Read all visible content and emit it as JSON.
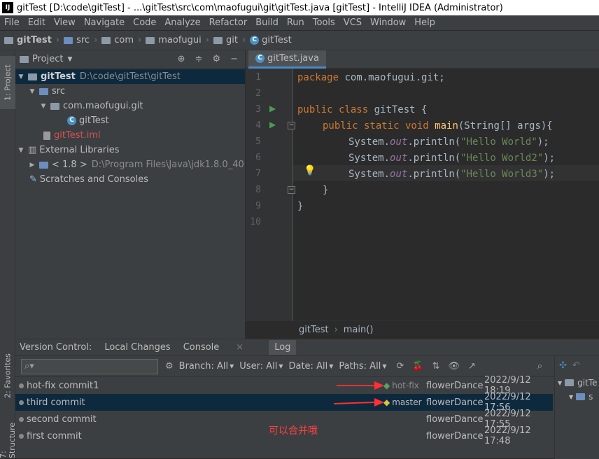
{
  "window": {
    "title": "gitTest [D:\\code\\gitTest] - ...\\gitTest\\src\\com\\maofugui\\git\\gitTest.java [gitTest] - IntelliJ IDEA (Administrator)",
    "logo": "IJ"
  },
  "menu": [
    "File",
    "Edit",
    "View",
    "Navigate",
    "Code",
    "Analyze",
    "Refactor",
    "Build",
    "Run",
    "Tools",
    "VCS",
    "Window",
    "Help"
  ],
  "breadcrumbs": [
    "gitTest",
    "src",
    "com",
    "maofugui",
    "git",
    "gitTest"
  ],
  "left_strip": {
    "project": "1: Project",
    "favorites": "2: Favorites",
    "structure": "7: Structure"
  },
  "project_panel": {
    "title": "Project",
    "tree": [
      {
        "label": "gitTest",
        "path": "D:\\code\\gitTest\\gitTest"
      },
      {
        "label": "src"
      },
      {
        "label": "com.maofugui.git"
      },
      {
        "label": "gitTest"
      },
      {
        "label": "gitTest.iml"
      },
      {
        "label": "External Libraries"
      },
      {
        "label": "< 1.8 >",
        "path": "D:\\Program Files\\Java\\jdk1.8.0_40"
      },
      {
        "label": "Scratches and Consoles"
      }
    ]
  },
  "editor": {
    "tab": "gitTest.java",
    "line_numbers": [
      "1",
      "2",
      "3",
      "4",
      "5",
      "6",
      "7",
      "8",
      "9",
      "10"
    ],
    "lines": {
      "l1a": "package",
      "l1b": " com.maofugui.git;",
      "l3a": "public class",
      "l3b": " gitTest {",
      "l4a": "public static void",
      "l4b": "main",
      "l4c": "(String[] args){",
      "sys": "System.",
      "out": "out",
      "println": ".println(",
      "s1": "\"Hello World\"",
      "s2": "\"Hello World2\"",
      "s3": "\"Hello World3\"",
      "end": ");",
      "close1": "}",
      "close2": "}"
    },
    "status": {
      "a": "gitTest",
      "b": "main()"
    }
  },
  "vcs": {
    "tabs": [
      "Version Control:",
      "Local Changes",
      "Console",
      "Log"
    ],
    "filters": [
      "Branch: All",
      "User: All",
      "Date: All",
      "Paths: All"
    ],
    "commits": [
      {
        "message": "hot-fix commit1",
        "tag": "hot-fix",
        "author": "flowerDance",
        "date": "2022/9/12 18:19"
      },
      {
        "message": "third commit",
        "tag": "master",
        "author": "flowerDance",
        "date": "2022/9/12 17:56"
      },
      {
        "message": "second commit",
        "tag": "",
        "author": "flowerDance",
        "date": "2022/9/12 17:55"
      },
      {
        "message": "first commit",
        "tag": "",
        "author": "flowerDance",
        "date": "2022/9/12 17:48"
      }
    ],
    "annotation": "可以合并哦",
    "right_tree": {
      "a": "gitTe",
      "b": "s"
    }
  },
  "colors": {
    "accent": "#4a88c7",
    "selection": "#0d293e",
    "annotation": "#ff4040"
  }
}
